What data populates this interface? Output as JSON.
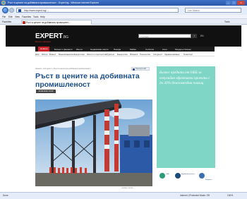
{
  "browser": {
    "window_title": "Ръст в цените на добивната промишленост - Expert.bg - Windows Internet Explorer",
    "url": "http://www.expert.bg/ ...",
    "search_placeholder": "Live Search",
    "menu": [
      "File",
      "Edit",
      "View",
      "Favorites",
      "Tools",
      "Help"
    ],
    "favorites_label": "Favorites",
    "tab_title": "Ръст в цените на добивната промишлен...",
    "tools_label": "Tools",
    "status_text": "Done",
    "zone_text": "Internet | Protected Mode: Off",
    "zoom_text": "100%"
  },
  "site": {
    "logo_main": "EXPERT",
    "logo_suffix": ".BG",
    "tagline": "Бизнес и финанси",
    "search_placeholder": "Търсене",
    "lang": "EN",
    "main_nav": [
      "Новини",
      "Бизнес и финанси",
      "Имоти",
      "Недвижими имоти",
      "Пазари",
      "Майки",
      "Събития",
      "Коли",
      "Модерен бизнес"
    ],
    "sub_nav": [
      "Дом",
      "Имоти",
      "Бизнес",
      "Мнения/анализи",
      "Енергетика",
      "Имоти и строителство",
      "Туризъм",
      "Енергетика",
      "Финанси",
      "Технологии",
      "Сигурност",
      "Здравеопазване",
      "Транспорт"
    ]
  },
  "article": {
    "breadcrumb": "Начало › Сигурност › Ръст в цените на добивната промишленост",
    "share_label": "Препоръчай",
    "headline": "Ръст в цените на добивната промишленост",
    "date": "24.09.2010, 15:40",
    "photo_caption": "Снимка: Архив"
  },
  "ad": {
    "text": "Бизнес кредити от ОББ за енергийно ефективни проекти с до 30% безвъзмездна помощ",
    "logo_labels": [
      "ОББ",
      "Европейска банка",
      "Bulgarian"
    ]
  },
  "colors": {
    "header_bg": "#111111",
    "nav_active": "#c9252a",
    "headline": "#1d4f8c",
    "ad_bg": "#7fd6c7"
  }
}
